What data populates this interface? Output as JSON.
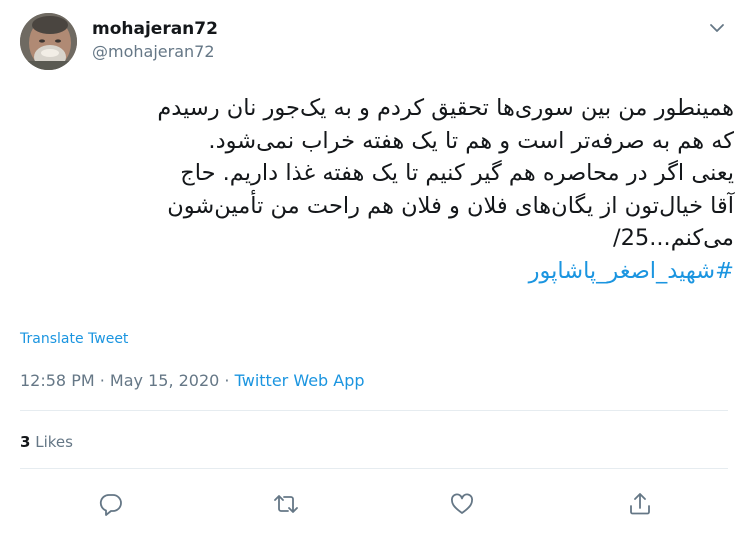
{
  "author": {
    "display_name": "mohajeran72",
    "handle": "@mohajeran72"
  },
  "tweet": {
    "text_lines": [
      "همینطور من بین سوری‌ها تحقیق کردم و به یک‌جور نان رسیدم",
      "که هم به صرفه‌تر است و هم تا یک هفته خراب نمی‌شود.",
      "یعنی اگر در محاصره هم گیر کنیم تا یک هفته غذا داریم. حاج",
      "آقا خیال‌تون از یگان‌های فلان و فلان هم راحت من تأمین‌شون",
      "می‌کنم...25/"
    ],
    "hashtag": "#شهید_اصغر_پاشاپور"
  },
  "translate_label": "Translate Tweet",
  "meta": {
    "time": "12:58 PM",
    "separator1": " · ",
    "date": "May 15, 2020",
    "separator2": " · ",
    "source": "Twitter Web App"
  },
  "likes": {
    "count": "3",
    "label": "Likes"
  },
  "actions": [
    {
      "icon": "reply-icon"
    },
    {
      "icon": "retweet-icon"
    },
    {
      "icon": "like-icon"
    },
    {
      "icon": "share-icon"
    }
  ],
  "colors": {
    "link": "#1b95e0",
    "muted": "#657786",
    "text": "#14171a",
    "divider": "#e6ecf0"
  }
}
